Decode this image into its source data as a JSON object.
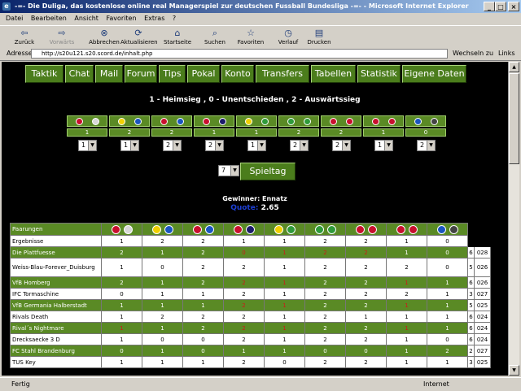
{
  "window": {
    "title": "-=- Die Duliga, das kostenlose online real Managerspiel zur deutschen Fussball Bundesliga -=- - Microsoft Internet Explorer"
  },
  "menu": [
    "Datei",
    "Bearbeiten",
    "Ansicht",
    "Favoriten",
    "Extras",
    "?"
  ],
  "toolbar": [
    {
      "label": "Zurück",
      "icon": "back-arrow-icon",
      "glyph": "⇦",
      "enabled": true
    },
    {
      "label": "Vorwärts",
      "icon": "forward-arrow-icon",
      "glyph": "⇨",
      "enabled": false
    },
    {
      "label": "Abbrechen",
      "icon": "stop-icon",
      "glyph": "⊗",
      "enabled": true
    },
    {
      "label": "Aktualisieren",
      "icon": "refresh-icon",
      "glyph": "⟳",
      "enabled": true
    },
    {
      "label": "Startseite",
      "icon": "home-icon",
      "glyph": "⌂",
      "enabled": true
    },
    {
      "label": "Suchen",
      "icon": "search-icon",
      "glyph": "⌕",
      "enabled": true
    },
    {
      "label": "Favoriten",
      "icon": "favorites-icon",
      "glyph": "☆",
      "enabled": true
    },
    {
      "label": "Verlauf",
      "icon": "history-icon",
      "glyph": "◷",
      "enabled": true
    },
    {
      "label": "Drucken",
      "icon": "print-icon",
      "glyph": "▤",
      "enabled": true
    }
  ],
  "address": {
    "label": "Adresse",
    "url": "http://s20u121.s20.scord.de/inhalt.php",
    "go": "Wechseln zu",
    "links": "Links"
  },
  "nav": [
    "Taktik",
    "Chat",
    "Mail",
    "Forum",
    "Tips",
    "Pokal",
    "Konto",
    "Transfers",
    "Tabellen",
    "Statistik",
    "Eigene Daten"
  ],
  "legend": "1 - Heimsieg , 0 - Unentschieden , 2 - Auswärtssieg",
  "matches": [
    {
      "home": "#c8102e",
      "away": "#d8d8d8",
      "result": "1",
      "tip": "1"
    },
    {
      "home": "#f0d000",
      "away": "#1a55c0",
      "result": "2",
      "tip": "1"
    },
    {
      "home": "#c8102e",
      "away": "#1a55c0",
      "result": "2",
      "tip": "2"
    },
    {
      "home": "#c8102e",
      "away": "#1b1b6a",
      "result": "1",
      "tip": "2"
    },
    {
      "home": "#f0d000",
      "away": "#2f9a3a",
      "result": "1",
      "tip": "1"
    },
    {
      "home": "#2f9a3a",
      "away": "#2f9a3a",
      "result": "2",
      "tip": "2"
    },
    {
      "home": "#c8102e",
      "away": "#c8102e",
      "result": "2",
      "tip": "2"
    },
    {
      "home": "#c8102e",
      "away": "#c8102e",
      "result": "1",
      "tip": "1"
    },
    {
      "home": "#1a55c0",
      "away": "#444444",
      "result": "0",
      "tip": "2"
    }
  ],
  "spieltag": {
    "value": "7",
    "label": "Spieltag"
  },
  "winner": {
    "text": "Gewinner: Ennatz",
    "quote_label": "Quote:",
    "quote_value": "2.65"
  },
  "table": {
    "header": "Paarungen",
    "rows": [
      {
        "name": "Ergebnisse",
        "style": "w",
        "cells": [
          "1",
          "2",
          "2",
          "1",
          "1",
          "2",
          "2",
          "1",
          "0"
        ],
        "red": [],
        "p1": "",
        "p2": ""
      },
      {
        "name": "Die Plattfuesse",
        "style": "g",
        "cells": [
          "2",
          "1",
          "2",
          "0",
          "1",
          "2",
          "2",
          "1",
          "0"
        ],
        "red": [
          3,
          4,
          5,
          6
        ],
        "p1": "6",
        "p2": "028"
      },
      {
        "name": "Weiss-Blau-Forever_Duisburg",
        "style": "w",
        "tall": true,
        "cells": [
          "1",
          "0",
          "2",
          "2",
          "1",
          "2",
          "2",
          "2",
          "0"
        ],
        "red": [],
        "p1": "5",
        "p2": "026"
      },
      {
        "name": "VfB Homberg",
        "style": "g",
        "cells": [
          "2",
          "1",
          "2",
          "2",
          "1",
          "2",
          "2",
          "1",
          "1"
        ],
        "red": [
          3,
          4,
          7
        ],
        "p1": "6",
        "p2": "026"
      },
      {
        "name": "IFC Tormaschine",
        "style": "w",
        "cells": [
          "0",
          "1",
          "1",
          "2",
          "1",
          "2",
          "2",
          "2",
          "1"
        ],
        "red": [],
        "p1": "3",
        "p2": "027"
      },
      {
        "name": "VfB Germania Halberstadt",
        "style": "g",
        "cells": [
          "1",
          "1",
          "1",
          "2",
          "1",
          "2",
          "2",
          "1",
          "1"
        ],
        "red": [
          3,
          4,
          7
        ],
        "p1": "5",
        "p2": "025"
      },
      {
        "name": "Rivals Death",
        "style": "w",
        "cells": [
          "1",
          "2",
          "2",
          "2",
          "1",
          "2",
          "1",
          "1",
          "1"
        ],
        "red": [],
        "p1": "6",
        "p2": "024"
      },
      {
        "name": "Rival´s Nightmare",
        "style": "g",
        "cells": [
          "1",
          "1",
          "2",
          "2",
          "1",
          "2",
          "2",
          "1",
          "1"
        ],
        "red": [
          0,
          3,
          4,
          7
        ],
        "p1": "6",
        "p2": "024"
      },
      {
        "name": "Drecksaecke 3 D",
        "style": "w",
        "cells": [
          "1",
          "0",
          "0",
          "2",
          "1",
          "2",
          "2",
          "1",
          "0"
        ],
        "red": [],
        "p1": "6",
        "p2": "024"
      },
      {
        "name": "FC Stahl Brandenburg",
        "style": "g",
        "cells": [
          "0",
          "1",
          "0",
          "1",
          "1",
          "0",
          "0",
          "1",
          "2"
        ],
        "red": [],
        "p1": "2",
        "p2": "027"
      },
      {
        "name": "TUS Key",
        "style": "w",
        "cells": [
          "1",
          "1",
          "1",
          "2",
          "0",
          "2",
          "2",
          "1",
          "1"
        ],
        "red": [],
        "p1": "3",
        "p2": "025"
      }
    ]
  },
  "status": {
    "left": "Fertig",
    "right": "Internet"
  }
}
